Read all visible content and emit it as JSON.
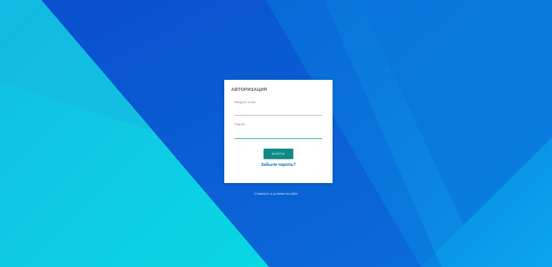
{
  "login_form": {
    "title": "АВТОРИЗАЦИЯ",
    "login_label": "Введите логин",
    "login_value": "",
    "password_label": "Пароль",
    "password_value": "",
    "submit_label": "ВОЙТИ",
    "forgot_password": "Забыли пароль?"
  },
  "footer": {
    "text": "Стоимость и условия на сайте",
    "link": "                    "
  },
  "colors": {
    "background_primary": "#0a5ad2",
    "background_light": "#12c8e0",
    "card_background": "#ffffff",
    "button": "#0f8a86",
    "active_underline": "#27ae60",
    "link": "#0a6ea8"
  }
}
